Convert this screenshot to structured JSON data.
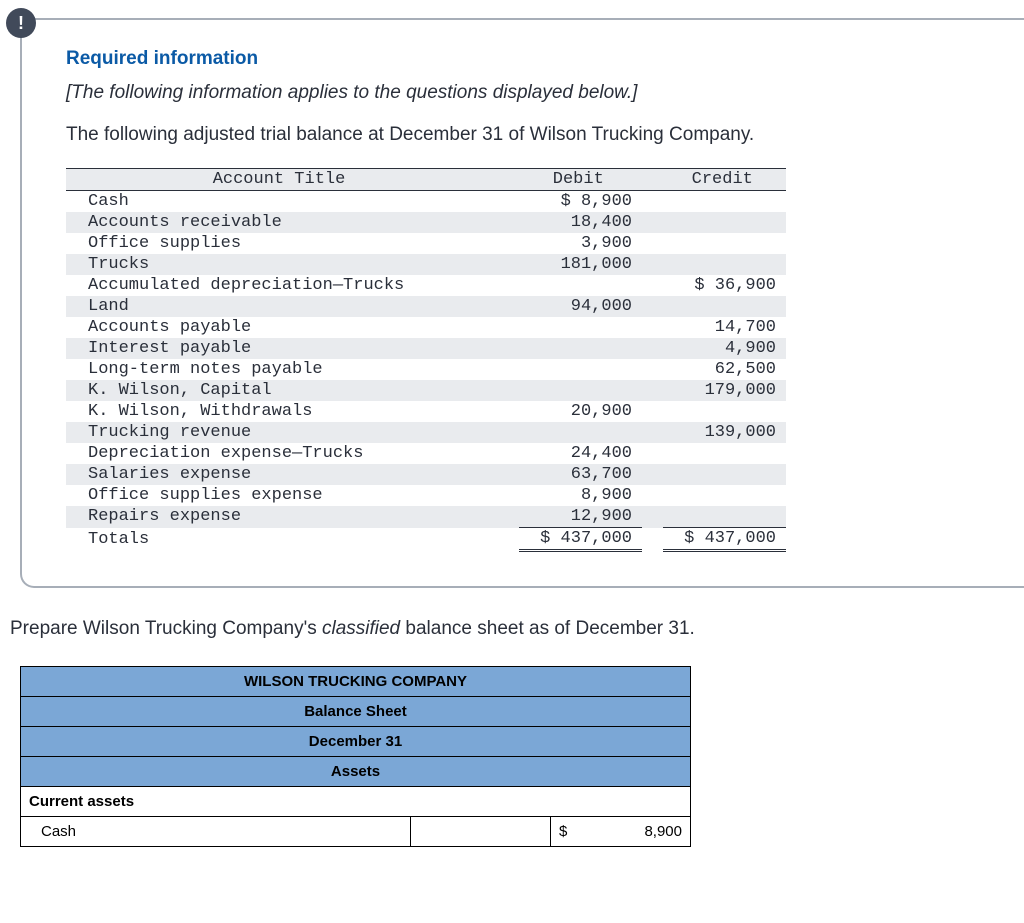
{
  "alert_glyph": "!",
  "info": {
    "required_title": "Required information",
    "applies_text": "[The following information applies to the questions displayed below.]",
    "intro_text": "The following adjusted trial balance at December 31 of Wilson Trucking Company."
  },
  "ledger": {
    "headers": {
      "account": "Account Title",
      "debit": "Debit",
      "credit": "Credit"
    },
    "rows": [
      {
        "account": "Cash",
        "debit": "$ 8,900",
        "credit": ""
      },
      {
        "account": "Accounts receivable",
        "debit": "18,400",
        "credit": ""
      },
      {
        "account": "Office supplies",
        "debit": "3,900",
        "credit": ""
      },
      {
        "account": "Trucks",
        "debit": "181,000",
        "credit": ""
      },
      {
        "account": "Accumulated depreciation—Trucks",
        "debit": "",
        "credit": "$ 36,900"
      },
      {
        "account": "Land",
        "debit": "94,000",
        "credit": ""
      },
      {
        "account": "Accounts payable",
        "debit": "",
        "credit": "14,700"
      },
      {
        "account": "Interest payable",
        "debit": "",
        "credit": "4,900"
      },
      {
        "account": "Long-term notes payable",
        "debit": "",
        "credit": "62,500"
      },
      {
        "account": "K. Wilson, Capital",
        "debit": "",
        "credit": "179,000"
      },
      {
        "account": "K. Wilson, Withdrawals",
        "debit": "20,900",
        "credit": ""
      },
      {
        "account": "Trucking revenue",
        "debit": "",
        "credit": "139,000"
      },
      {
        "account": "Depreciation expense—Trucks",
        "debit": "24,400",
        "credit": ""
      },
      {
        "account": "Salaries expense",
        "debit": "63,700",
        "credit": ""
      },
      {
        "account": "Office supplies expense",
        "debit": "8,900",
        "credit": ""
      },
      {
        "account": "Repairs expense",
        "debit": "12,900",
        "credit": ""
      }
    ],
    "totals": {
      "label": "Totals",
      "debit": "$ 437,000",
      "credit": "$ 437,000"
    }
  },
  "prepare_prefix": "Prepare Wilson Trucking Company's ",
  "prepare_ital": "classified",
  "prepare_suffix": " balance sheet as of December 31.",
  "balance_sheet": {
    "title": "WILSON TRUCKING COMPANY",
    "subtitle": "Balance Sheet",
    "date": "December 31",
    "assets_header": "Assets",
    "section_current": "Current assets",
    "entry": {
      "label": "Cash",
      "currency": "$",
      "value": "8,900"
    }
  }
}
